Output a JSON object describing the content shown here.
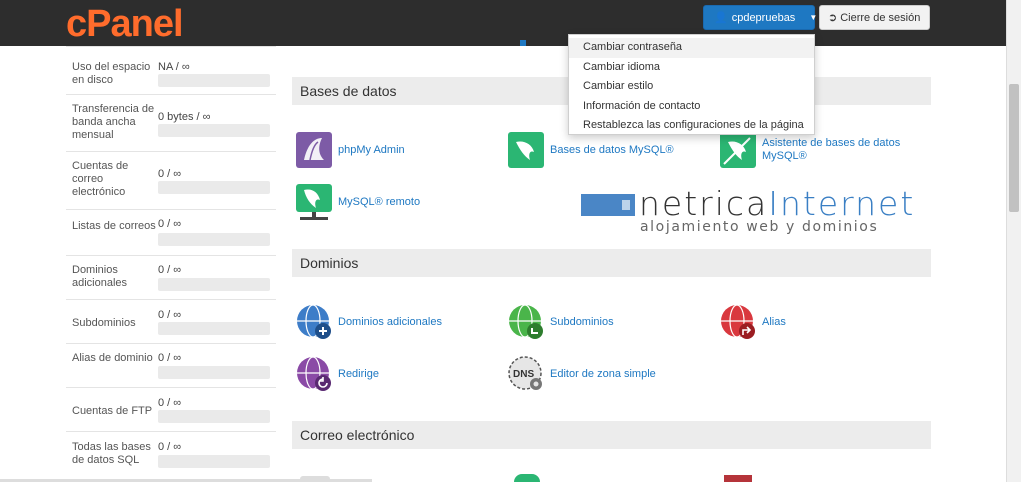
{
  "header": {
    "logo": "cPanel",
    "user_label": "cpdepruebas",
    "logout_label": "Cierre de sesión"
  },
  "user_menu": {
    "items": [
      "Cambiar contraseña",
      "Cambiar idioma",
      "Cambiar estilo",
      "Información de contacto",
      "Restablezca las configuraciones de la página"
    ]
  },
  "sidebar": {
    "stats": [
      {
        "label": "Uso del espacio en disco",
        "value": "NA / ∞"
      },
      {
        "label": "Transferencia de banda ancha mensual",
        "value": "0 bytes / ∞"
      },
      {
        "label": "Cuentas de correo electrónico",
        "value": "0 / ∞"
      },
      {
        "label": "Listas de correos",
        "value": "0 / ∞"
      },
      {
        "label": "Dominios adicionales",
        "value": "0 / ∞"
      },
      {
        "label": "Subdominios",
        "value": "0 / ∞"
      },
      {
        "label": "Alias de dominio",
        "value": "0 / ∞"
      },
      {
        "label": "Cuentas de FTP",
        "value": "0 / ∞"
      },
      {
        "label": "Todas las bases de datos SQL",
        "value": "0 / ∞"
      }
    ]
  },
  "sections": {
    "databases": {
      "title": "Bases de datos",
      "items": [
        "phpMy Admin",
        "Bases de datos MySQL®",
        "Asistente de bases de datos MySQL®",
        "MySQL® remoto"
      ]
    },
    "domains": {
      "title": "Dominios",
      "items": [
        "Dominios adicionales",
        "Subdominios",
        "Alias",
        "Redirige",
        "Editor de zona simple"
      ]
    },
    "email": {
      "title": "Correo electrónico"
    }
  },
  "watermark": {
    "word1": "netrica",
    "word2": "Internet",
    "tagline": "alojamiento web y dominios"
  },
  "colors": {
    "brand_orange": "#ff6c2c",
    "header_dark": "#2d2d2d",
    "link_blue": "#1e78c2"
  }
}
